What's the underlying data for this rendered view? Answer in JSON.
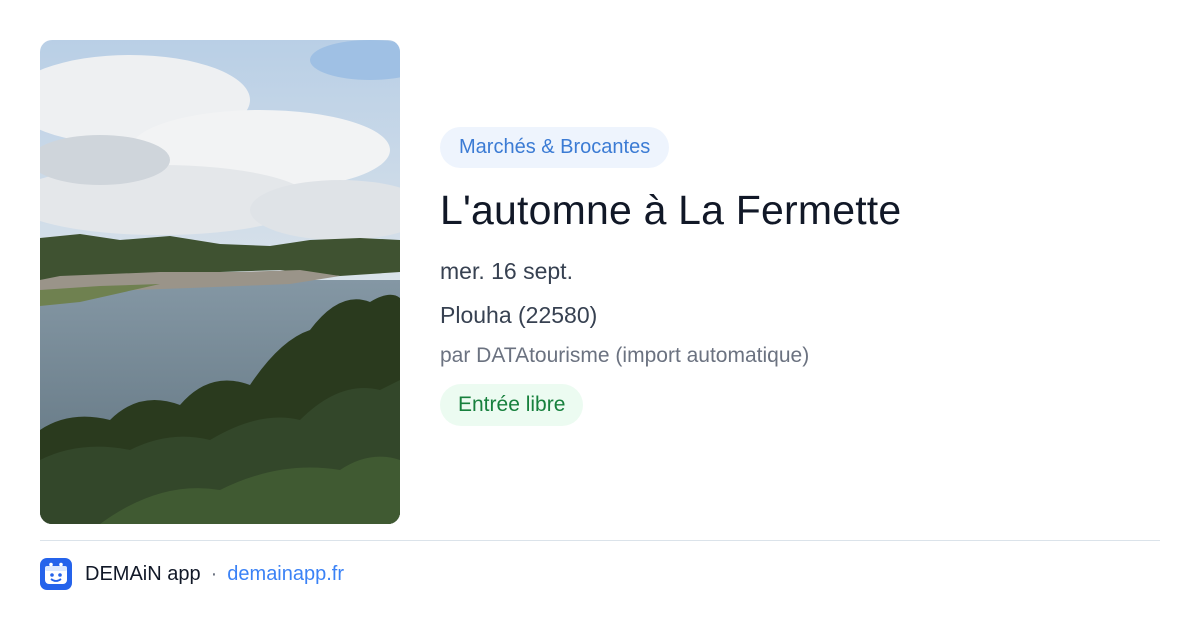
{
  "event": {
    "category": "Marchés & Brocantes",
    "title": "L'automne à La Fermette",
    "date": "mer. 16 sept.",
    "location": "Plouha (22580)",
    "source": "par DATAtourisme (import automatique)",
    "price": "Entrée libre",
    "image_icon": "coastal-bay-photo"
  },
  "footer": {
    "app_name": "DEMAiN app",
    "separator": "·",
    "link": "demainapp.fr",
    "logo_icon": "demain-app-logo-icon"
  },
  "colors": {
    "category_bg": "#eef4fd",
    "category_text": "#3b7bd4",
    "price_bg": "#ecfbf1",
    "price_text": "#17803d",
    "brand_blue": "#2563eb",
    "link": "#3b82f6"
  }
}
